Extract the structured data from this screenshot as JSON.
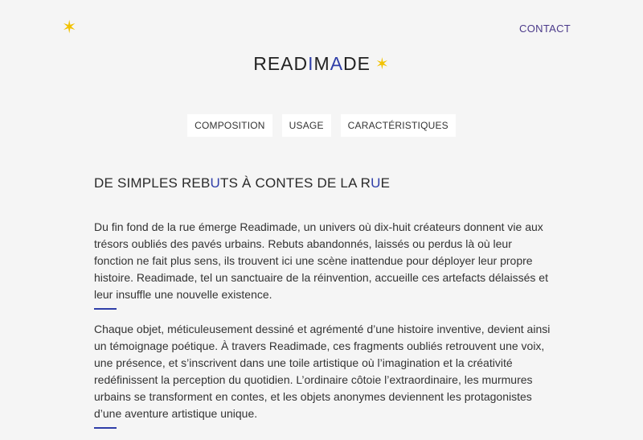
{
  "header": {
    "contact_label": "CONTACT",
    "logo": {
      "part1": "READ",
      "accent1": "I",
      "part2": "M",
      "accent2": "A",
      "part3": "DE"
    }
  },
  "tabs": [
    {
      "label": "COMPOSITION"
    },
    {
      "label": "USAGE"
    },
    {
      "label": "CARACTÉRISTIQUES"
    }
  ],
  "heading": {
    "part1": "DE SIMPLES REB",
    "accent1": "U",
    "part2": "TS À CONTES DE LA R",
    "accent2": "U",
    "part3": "E"
  },
  "paragraphs": [
    "Du fin fond de la rue émerge Readimade, un univers où dix-huit créateurs donnent vie aux trésors oubliés des pavés urbains. Rebuts abandonnés, laissés ou perdus là où leur fonction ne fait plus sens, ils trouvent ici une scène inattendue pour déployer leur propre histoire. Readimade, tel un sanctuaire de la réinvention, accueille ces artefacts délaissés et leur insuffle une nouvelle existence.",
    "Chaque objet, méticuleusement dessiné et agrémenté d’une histoire inventive, devient ainsi un témoignage poétique. À travers Readimade, ces fragments oubliés retrouvent une voix, une présence, et s’inscrivent dans une toile artistique où l’imagination et la créativité redéfinissent la perception du quotidien. L’ordinaire côtoie l’extraordinaire, les murmures urbains se transforment en contes, et les objets anonymes deviennent les protagonistes d’une aventure artistique unique."
  ],
  "colors": {
    "accent": "#2f3ea8",
    "star": "#f2c200",
    "background": "#f5f5f5"
  },
  "icons": {
    "corner": "star-icon",
    "logo": "star-icon"
  }
}
